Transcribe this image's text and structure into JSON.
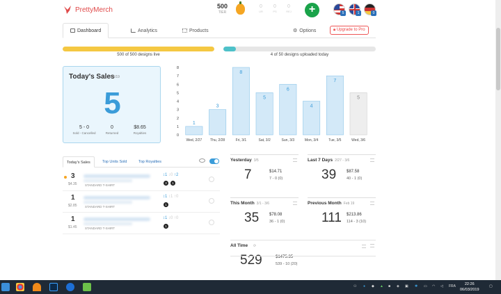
{
  "brand": {
    "name": "PrettyMerch",
    "color": "#e04a4a"
  },
  "header": {
    "tier_value": "500",
    "tier_label": "TIER",
    "stats": [
      {
        "value": "0",
        "label": "UR"
      },
      {
        "value": "0",
        "label": "PS"
      },
      {
        "value": "0",
        "label": "REJ"
      }
    ],
    "add_label": "+",
    "flags": [
      {
        "name": "us-flag-icon",
        "count": "5"
      },
      {
        "name": "uk-flag-icon",
        "count": "1"
      },
      {
        "name": "de-flag-icon",
        "count": "0"
      }
    ]
  },
  "tabs": [
    {
      "label": "Dashboard",
      "icon": "monitor-icon"
    },
    {
      "label": "Analytics",
      "icon": "bar-chart-icon"
    },
    {
      "label": "Products",
      "icon": "grid-icon"
    },
    {
      "label": "Options",
      "icon": "gear-icon"
    }
  ],
  "upgrade_label": "Upgrade to Pro",
  "progress": [
    {
      "label": "500 of 500 designs live",
      "fraction": 1.0,
      "color": "#f5c842"
    },
    {
      "label": "4 of 50 designs uploaded today",
      "fraction": 0.08,
      "color": "#4ec1c9"
    }
  ],
  "today": {
    "title": "Today's Sales",
    "date": "3/6/19",
    "count": "5",
    "sold_cancelled": "5 - 0",
    "sold_cancelled_label": "Sold - Cancelled",
    "returned": "0",
    "returned_label": "Returned",
    "royalties": "$8.65",
    "royalties_label": "Royalties"
  },
  "chart_data": {
    "type": "bar",
    "categories": [
      "Wed, 2/27",
      "Thu, 2/28",
      "Fri, 3/1",
      "Sat, 3/2",
      "Sun, 3/3",
      "Mon, 3/4",
      "Tue, 3/5",
      "Wed, 3/6"
    ],
    "values": [
      1,
      3,
      8,
      5,
      6,
      4,
      7,
      5
    ],
    "ylim": [
      0,
      8
    ],
    "yticks": [
      0,
      1,
      2,
      3,
      4,
      5,
      6,
      7,
      8
    ],
    "title": "",
    "xlabel": "",
    "ylabel": "",
    "grid": false,
    "bar_color": "#d3e9f8",
    "last_bar_color": "#eeeeee",
    "label_color": "#3b9cd9"
  },
  "sales_tabs": [
    "Today's Sales",
    "Top Units Sold",
    "Top Royalties"
  ],
  "sales": [
    {
      "qty": "3",
      "amount": "$4.35",
      "type": "STANDARD T-SHIRT",
      "icon_a": "1",
      "icon_b": "0",
      "icon_c": "2",
      "badges": [
        "3",
        "1"
      ]
    },
    {
      "qty": "1",
      "amount": "$2.85",
      "type": "STANDARD T-SHIRT",
      "icon_a": "1",
      "icon_b": "1",
      "icon_c": "0",
      "badges": [
        "1"
      ]
    },
    {
      "qty": "1",
      "amount": "$1.45",
      "type": "STANDARD T-SHIRT",
      "icon_a": "1",
      "icon_b": "0",
      "icon_c": "0",
      "badges": [
        "1"
      ]
    }
  ],
  "cards": [
    {
      "title": "Yesterday",
      "range": "3/5",
      "big": "7",
      "royalty": "$14.71",
      "detail": "7 - 0 (0)"
    },
    {
      "title": "Last 7 Days",
      "range": "2/27 - 3/6",
      "big": "39",
      "royalty": "$87.58",
      "detail": "40 - 1 (0)"
    },
    {
      "title": "This Month",
      "range": "3/1 - 3/6",
      "big": "35",
      "royalty": "$78.08",
      "detail": "36 - 1 (0)"
    },
    {
      "title": "Previous Month",
      "range": "Feb 19",
      "big": "111",
      "royalty": "$213.86",
      "detail": "114 - 3 (10)"
    },
    {
      "title": "All Time",
      "range": "",
      "big": "529",
      "royalty": "$1475.35",
      "detail": "539 - 10 (20)"
    }
  ],
  "taskbar": {
    "lang": "FRA",
    "time": "22:26",
    "date": "06/03/2019"
  }
}
